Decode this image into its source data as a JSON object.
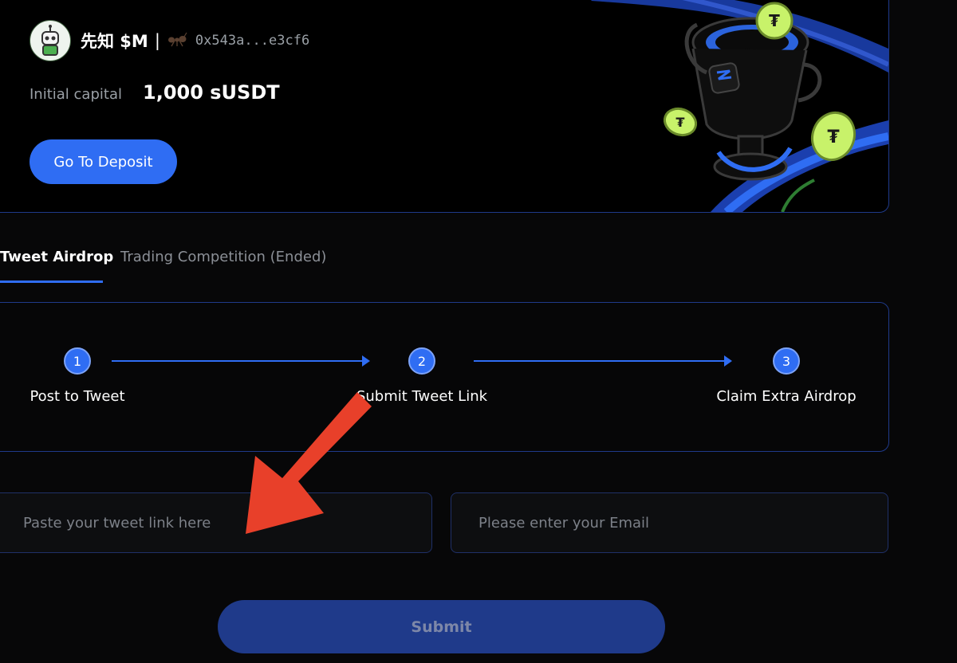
{
  "profile": {
    "username": "先知 $M",
    "separator": "|",
    "address": "0x543a...e3cf6",
    "avatar_icon": "robot-avatar-icon",
    "badge_icon": "ant-icon"
  },
  "capital": {
    "label": "Initial capital",
    "value": "1,000 sUSDT"
  },
  "deposit_button": "Go To Deposit",
  "tabs": [
    {
      "label": "Tweet Airdrop",
      "active": true
    },
    {
      "label": "Trading Competition (Ended)",
      "active": false
    }
  ],
  "steps": [
    {
      "number": "1",
      "label": "Post to Tweet"
    },
    {
      "number": "2",
      "label": "Submit Tweet Link"
    },
    {
      "number": "3",
      "label": "Claim Extra Airdrop"
    }
  ],
  "form": {
    "tweet_placeholder": "Paste your tweet link here",
    "email_placeholder": "Please enter your Email",
    "submit_label": "Submit"
  },
  "colors": {
    "accent": "#2f6df3",
    "border": "#1f3a8a",
    "annotation_arrow": "#e8402a",
    "coin": "#c8f26a"
  }
}
